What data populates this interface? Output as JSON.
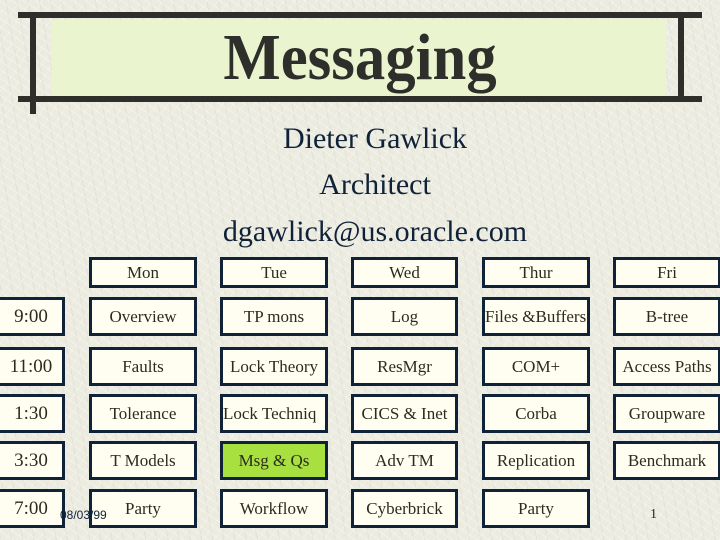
{
  "slide": {
    "title": "Messaging",
    "author": "Dieter Gawlick",
    "role": "Architect",
    "email": "dgawlick@us.oracle.com"
  },
  "schedule": {
    "days": [
      "Mon",
      "Tue",
      "Wed",
      "Thur",
      "Fri"
    ],
    "rows": [
      {
        "time": "9:00",
        "sessions": [
          "Overview",
          "TP mons",
          "Log",
          "Files &Buffers",
          "B-tree"
        ]
      },
      {
        "time": "11:00",
        "sessions": [
          "Faults",
          "Lock Theory",
          "ResMgr",
          "COM+",
          "Access Paths"
        ]
      },
      {
        "time": "1:30",
        "sessions": [
          "Tolerance",
          "Lock Techniq",
          "CICS & Inet",
          "Corba",
          "Groupware"
        ]
      },
      {
        "time": "3:30",
        "sessions": [
          "T Models",
          "Msg & Qs",
          "Adv TM",
          "Replication",
          "Benchmark"
        ]
      },
      {
        "time": "7:00",
        "sessions": [
          "Party",
          "Workflow",
          "Cyberbrick",
          "Party",
          null
        ]
      }
    ],
    "highlighted": {
      "row": 3,
      "day": 1,
      "color": "#A8E040"
    }
  },
  "footer": {
    "date": "08/03/99",
    "page_number": "1"
  }
}
